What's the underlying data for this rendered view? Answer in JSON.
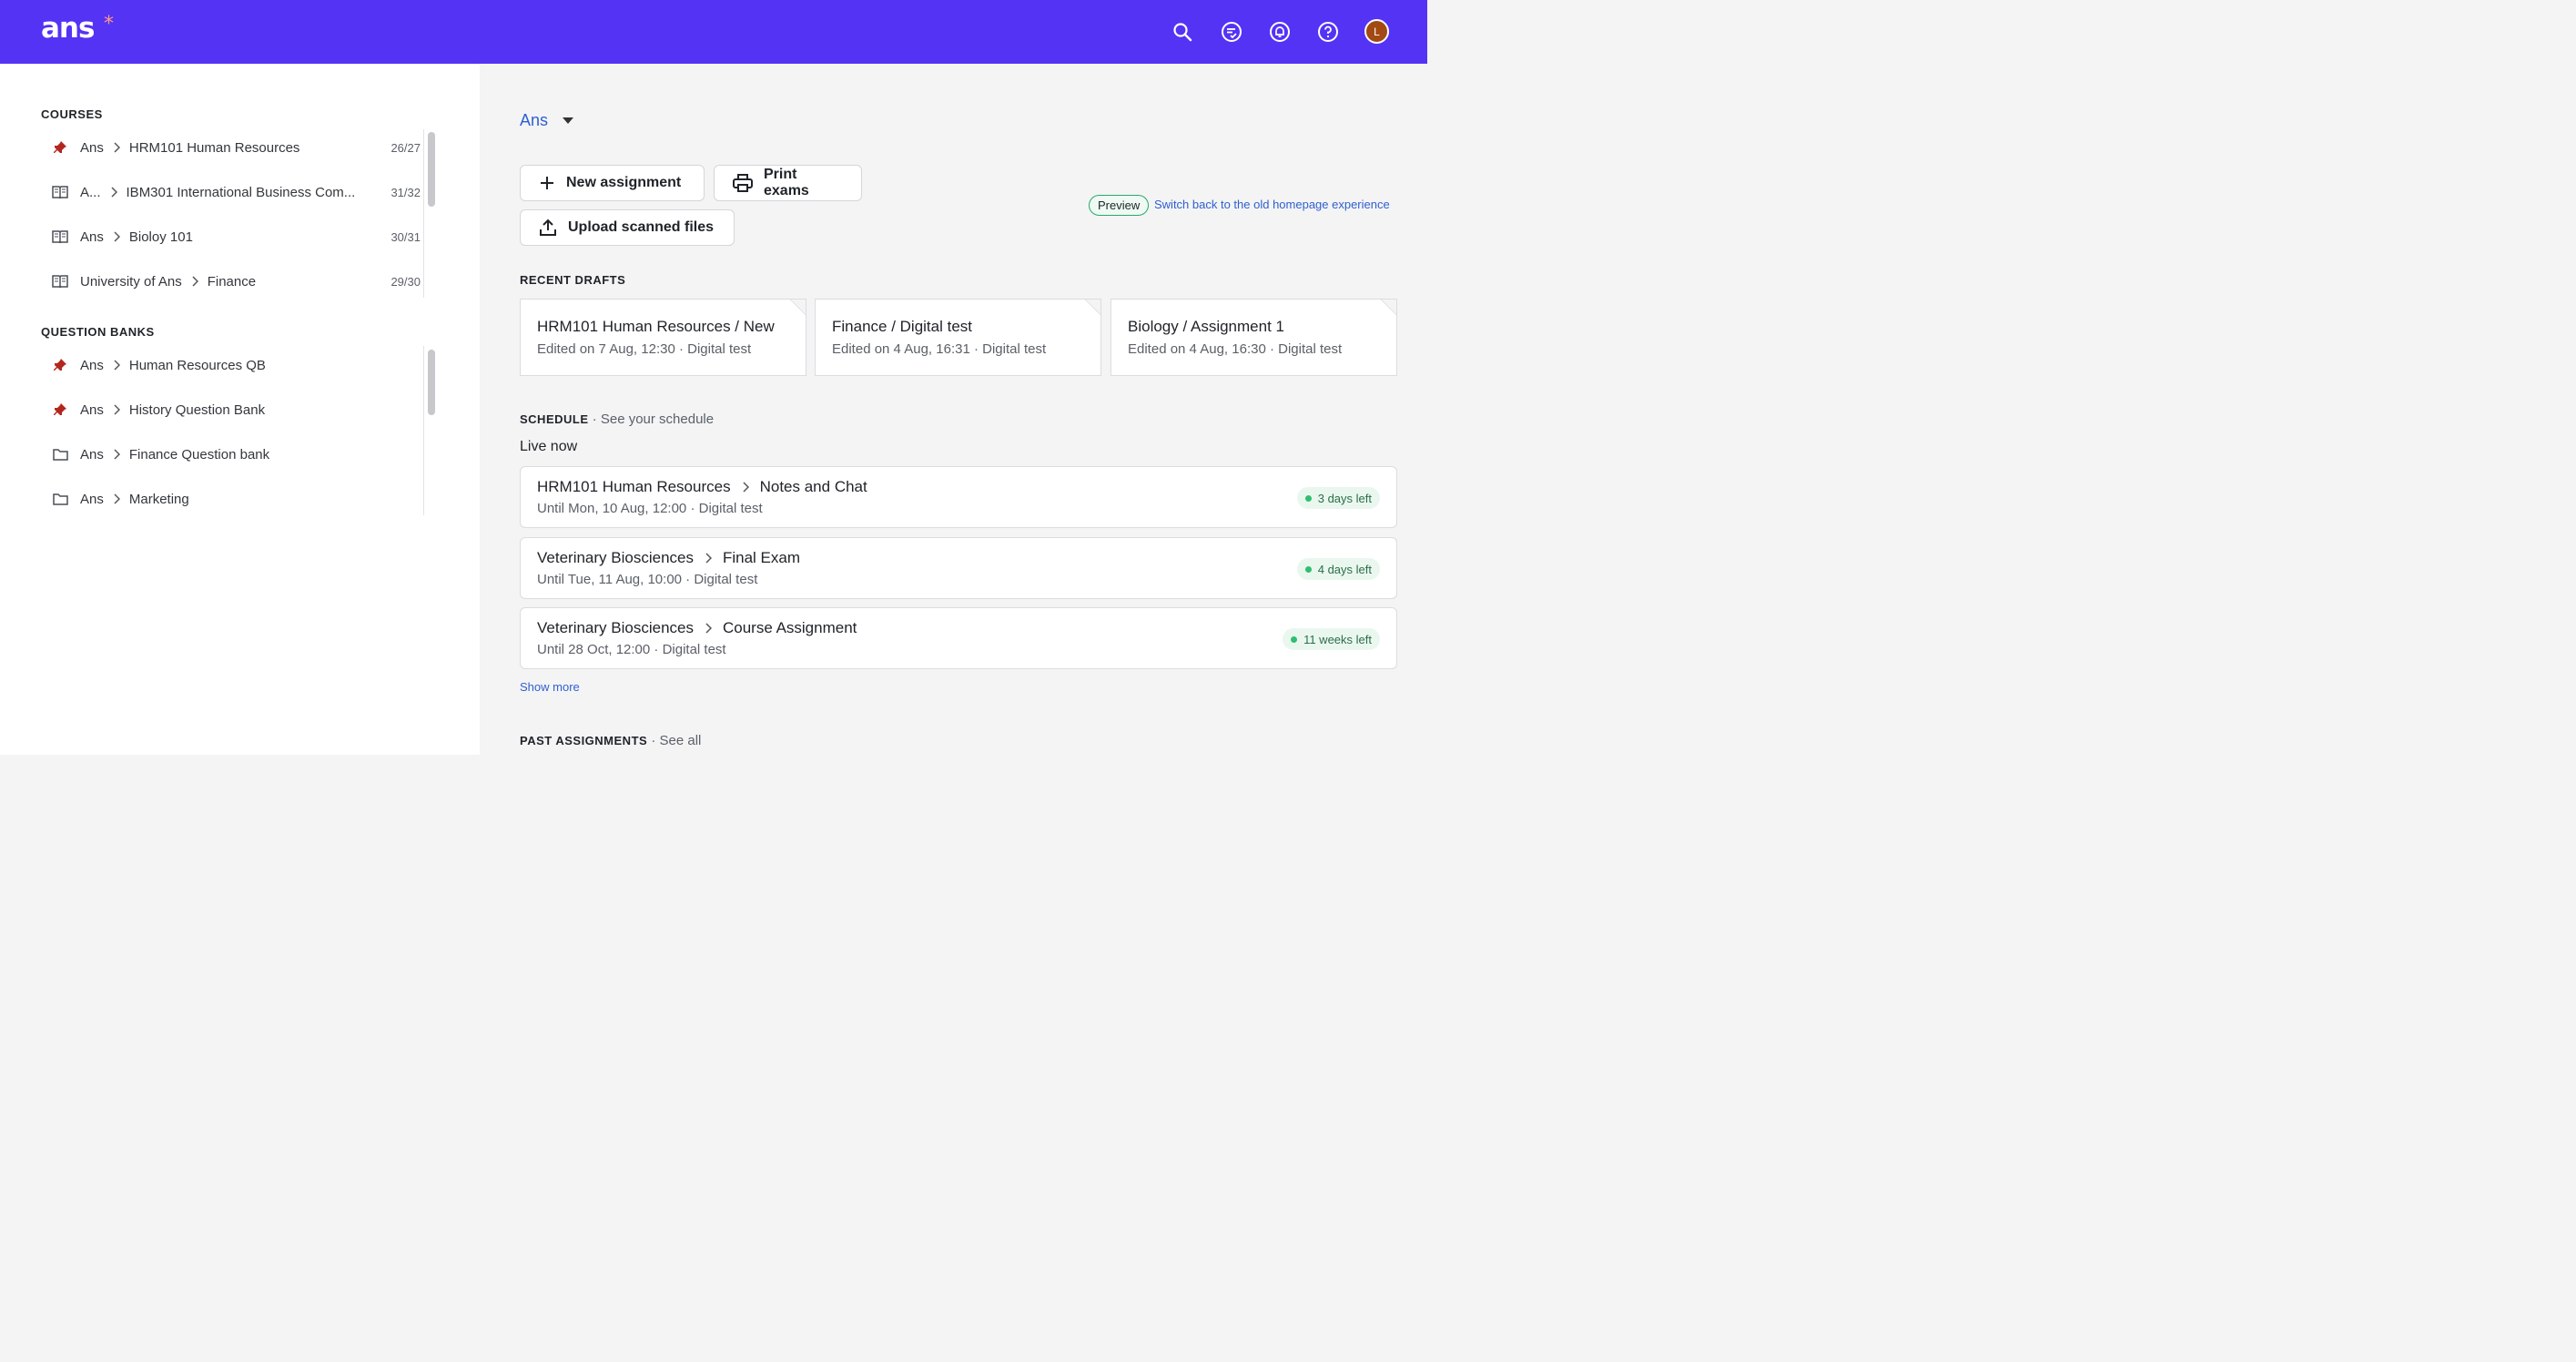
{
  "header": {
    "logo_text": "ans",
    "logo_star": "*",
    "avatar_initial": "L",
    "icons": [
      "search-icon",
      "review-icon",
      "bell-icon",
      "help-icon"
    ]
  },
  "sidebar": {
    "courses_title": "COURSES",
    "courses": [
      {
        "icon": "pin-icon",
        "parent": "Ans",
        "name": "HRM101 Human Resources",
        "count": "26/27"
      },
      {
        "icon": "book-icon",
        "parent": "A...",
        "name": "IBM301 International Business Com...",
        "count": "31/32"
      },
      {
        "icon": "book-icon",
        "parent": "Ans",
        "name": "Bioloy 101",
        "count": "30/31"
      },
      {
        "icon": "book-icon",
        "parent": "University of Ans",
        "name": "Finance",
        "count": "29/30"
      }
    ],
    "banks_title": "QUESTION BANKS",
    "banks": [
      {
        "icon": "pin-icon",
        "parent": "Ans",
        "name": "Human Resources QB"
      },
      {
        "icon": "pin-icon",
        "parent": "Ans",
        "name": "History Question Bank"
      },
      {
        "icon": "folder-icon",
        "parent": "Ans",
        "name": "Finance Question bank"
      },
      {
        "icon": "folder-icon",
        "parent": "Ans",
        "name": "Marketing"
      }
    ]
  },
  "main": {
    "org_name": "Ans",
    "buttons": {
      "new_assignment": "New assignment",
      "print_exams": "Print exams",
      "upload_scanned": "Upload scanned files"
    },
    "preview_label": "Preview",
    "switch_link": "Switch back to the old homepage experience",
    "recent_drafts_title": "RECENT DRAFTS",
    "drafts": [
      {
        "title": "HRM101 Human Resources / New",
        "meta": "Edited on 7 Aug, 12:30 · Digital test"
      },
      {
        "title": "Finance / Digital test",
        "meta": "Edited on 4 Aug, 16:31 · Digital test"
      },
      {
        "title": "Biology / Assignment 1",
        "meta": "Edited on 4 Aug, 16:30 · Digital test"
      }
    ],
    "schedule_title": "SCHEDULE",
    "schedule_link": " · See your schedule",
    "live_now": "Live now",
    "schedule": [
      {
        "course": "HRM101 Human Resources",
        "assignment": "Notes and Chat",
        "meta": "Until Mon, 10 Aug, 12:00 · Digital test",
        "badge": "3 days left"
      },
      {
        "course": "Veterinary Biosciences",
        "assignment": "Final Exam",
        "meta": "Until Tue, 11 Aug, 10:00 · Digital test",
        "badge": "4 days left"
      },
      {
        "course": "Veterinary Biosciences",
        "assignment": "Course Assignment",
        "meta": "Until 28 Oct, 12:00 · Digital test",
        "badge": "11 weeks left"
      }
    ],
    "show_more": "Show more",
    "past_title": "PAST ASSIGNMENTS",
    "past_link": " · See all"
  },
  "colors": {
    "brand": "#5433f5",
    "accent_link": "#2f5fd0",
    "pin": "#b3261e",
    "status_green": "#2fbf71"
  }
}
